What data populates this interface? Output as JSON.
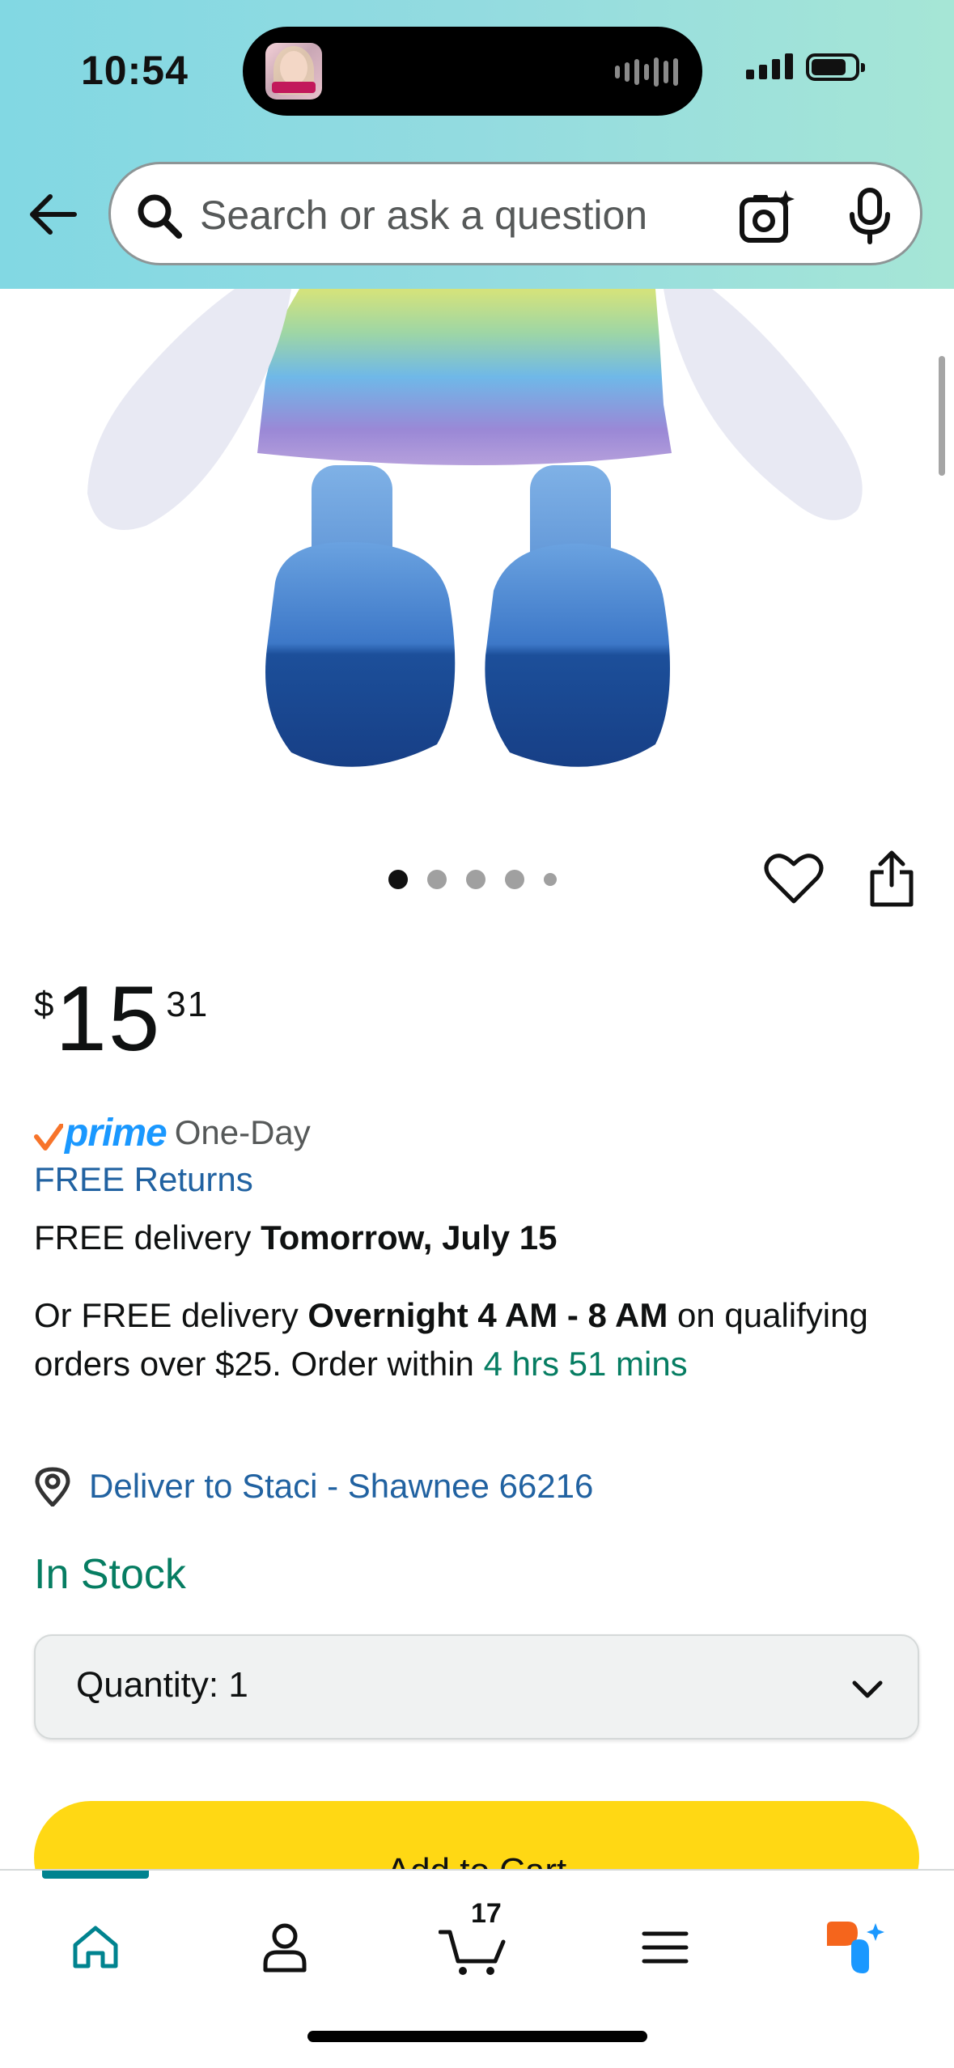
{
  "status_bar": {
    "time": "10:54"
  },
  "search": {
    "placeholder": "Search or ask a question"
  },
  "gallery": {
    "dot_count": 5,
    "active_index": 0
  },
  "price": {
    "currency": "$",
    "whole": "15",
    "fraction": "31"
  },
  "shipping": {
    "prime_label": "prime",
    "prime_type": "One-Day",
    "free_returns": "FREE Returns",
    "free_delivery_prefix": "FREE delivery ",
    "free_delivery_date": "Tomorrow, July 15",
    "overnight_prefix": "Or FREE delivery ",
    "overnight_window": "Overnight 4 AM - 8 AM",
    "overnight_middle": " on qualifying orders over $25. Order within ",
    "countdown": "4 hrs 51 mins"
  },
  "delivery": {
    "deliver_to": "Deliver to Staci - Shawnee 66216"
  },
  "stock": {
    "status": "In Stock"
  },
  "quantity": {
    "label": "Quantity:",
    "value": "1"
  },
  "actions": {
    "add_to_cart": "Add to Cart"
  },
  "bottom_nav": {
    "cart_count": "17",
    "items": [
      "home-icon",
      "profile-icon",
      "cart-icon",
      "menu-icon",
      "rufus-icon"
    ],
    "active": "home"
  },
  "colors": {
    "link_blue": "#2162a1",
    "stock_green": "#067d62",
    "add_to_cart_yellow": "#ffd814",
    "prime_blue": "#1a98ff",
    "nav_active_teal": "#00838f"
  }
}
